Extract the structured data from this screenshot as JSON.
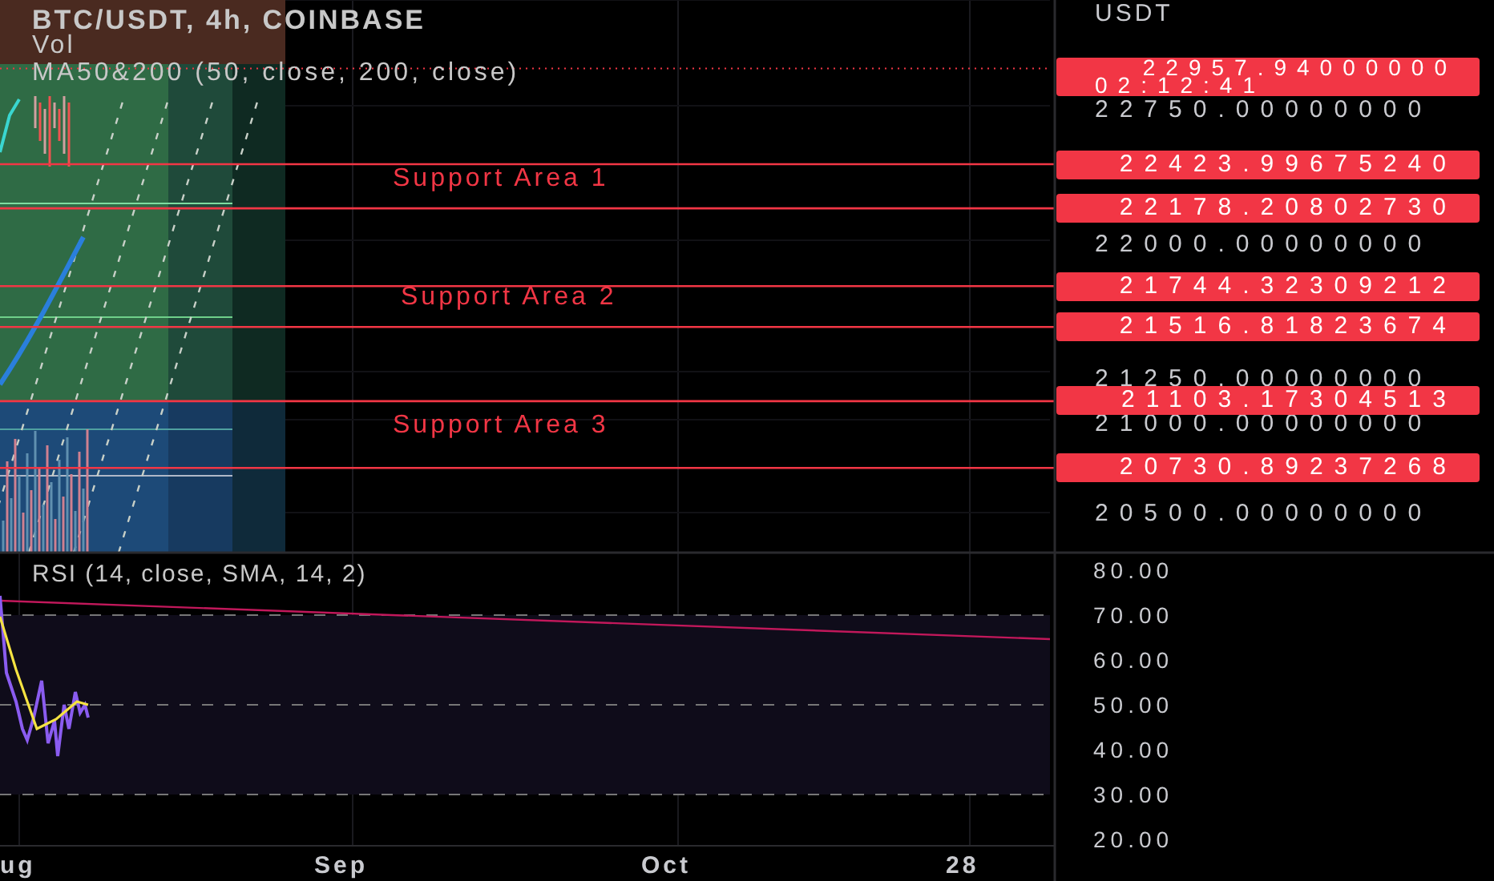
{
  "header": {
    "symbol": "BTC/USDT, 4h, COINBASE",
    "indicators": [
      "Vol",
      "MA50&200 (50, close, 200, close)"
    ]
  },
  "price_axis": {
    "currency": "USDT",
    "ticks": [
      "22750.00000000",
      "22000.00000000",
      "21250.00000000",
      "21000.00000000",
      "20500.00000000"
    ]
  },
  "last_price": {
    "price": "22957.94000000",
    "countdown": "02:12:41"
  },
  "support_areas": [
    {
      "label": "Support Area 1",
      "upper": "22423.99675240",
      "lower": "22178.20802730"
    },
    {
      "label": "Support Area 2",
      "upper": "21744.32309212",
      "lower": "21516.81823674"
    },
    {
      "label": "Support Area 3",
      "upper": "21103.17304513",
      "lower": "20730.89237268"
    }
  ],
  "rsi_pane": {
    "title": "RSI (14, close, SMA, 14, 2)",
    "ticks": [
      "80.00",
      "70.00",
      "60.00",
      "50.00",
      "40.00",
      "30.00",
      "20.00"
    ]
  },
  "time_axis": {
    "labels": [
      "ug",
      "Sep",
      "Oct",
      "28"
    ]
  }
}
